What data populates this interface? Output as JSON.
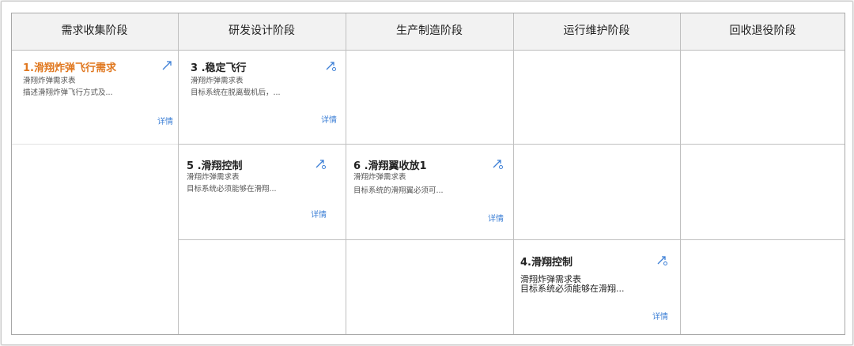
{
  "headers": [
    "需求收集阶段",
    "研发设计阶段",
    "生产制造阶段",
    "运行维护阶段",
    "回收退役阶段"
  ],
  "cards": [
    {
      "title": "1.滑翔炸弹飞行需求",
      "type": "滑翔炸弹需求表",
      "desc": "描述滑翔炸弹飞行方式及...",
      "detail": "详情",
      "icon": "expand-arrow-icon"
    },
    {
      "title": "3 .稳定飞行",
      "type": "滑翔炸弹需求表",
      "desc": "目标系统在脱离载机后，...",
      "detail": "详情",
      "icon": "trace-link-icon"
    },
    {
      "title": "5 .滑翔控制",
      "type": "滑翔炸弹需求表",
      "desc": "目标系统必须能够在滑翔...",
      "detail": "详情",
      "icon": "trace-link-icon"
    },
    {
      "title": "6 .滑翔翼收放1",
      "type": "滑翔炸弹需求表",
      "desc": "目标系统的滑翔翼必须可...",
      "detail": "详情",
      "icon": "trace-link-icon"
    },
    {
      "title": "4.滑翔控制",
      "type": "滑翔炸弹需求表",
      "desc": "目标系统必须能够在滑翔...",
      "detail": "详情",
      "icon": "trace-link-icon"
    }
  ]
}
